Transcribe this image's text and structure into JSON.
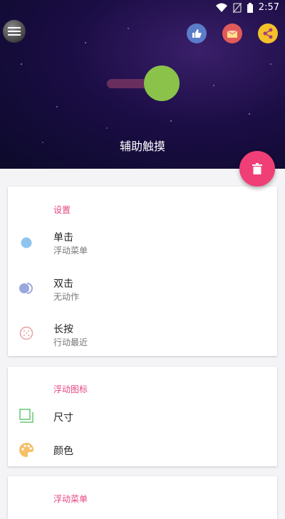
{
  "status": {
    "time": "2:57"
  },
  "header": {
    "title": "辅助触摸"
  },
  "icons": {
    "menu": "hamburger-icon",
    "like": "thumb-up-icon",
    "mail": "mail-icon",
    "share": "share-icon",
    "delete": "trash-icon"
  },
  "colors": {
    "accent": "#e64582",
    "fab": "#ef3f76",
    "toggle_knob": "#8bc34a",
    "toggle_track": "#6a2e5e"
  },
  "sections": {
    "settings": {
      "title": "设置",
      "items": [
        {
          "title": "单击",
          "subtitle": "浮动菜单"
        },
        {
          "title": "双击",
          "subtitle": "无动作"
        },
        {
          "title": "长按",
          "subtitle": "行动最近"
        }
      ]
    },
    "floating_icon": {
      "title": "浮动图标",
      "items": [
        {
          "title": "尺寸"
        },
        {
          "title": "颜色"
        }
      ]
    },
    "floating_menu": {
      "title": "浮动菜单"
    }
  }
}
